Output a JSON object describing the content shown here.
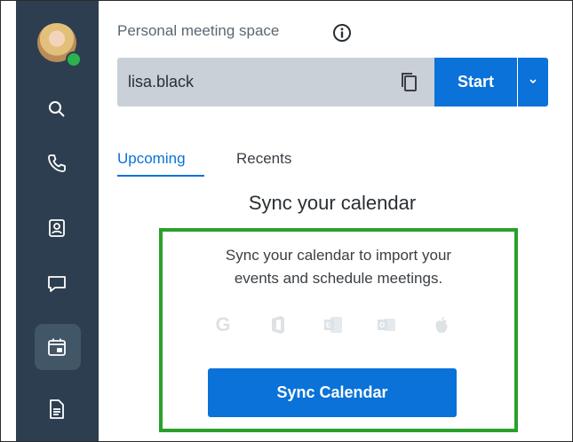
{
  "meeting": {
    "label": "Personal meeting space",
    "value": "lisa.black",
    "start_label": "Start"
  },
  "tabs": [
    {
      "label": "Upcoming",
      "active": true
    },
    {
      "label": "Recents",
      "active": false
    }
  ],
  "sync": {
    "heading": "Sync your calendar",
    "line1": "Sync your calendar to import your",
    "line2": "events and schedule meetings.",
    "button_label": "Sync Calendar",
    "providers": [
      "google-icon",
      "office-icon",
      "exchange-icon",
      "outlook-icon",
      "apple-icon"
    ]
  },
  "sidebar": {
    "items": [
      "search-icon",
      "phone-icon",
      "contacts-icon",
      "chat-icon",
      "calendar-icon",
      "notes-icon"
    ],
    "active_item": "calendar-icon"
  },
  "colors": {
    "accent": "#0a72d8",
    "sidebar": "#2c3e50",
    "highlight": "#2aa02a",
    "presence": "#2bb24c"
  }
}
